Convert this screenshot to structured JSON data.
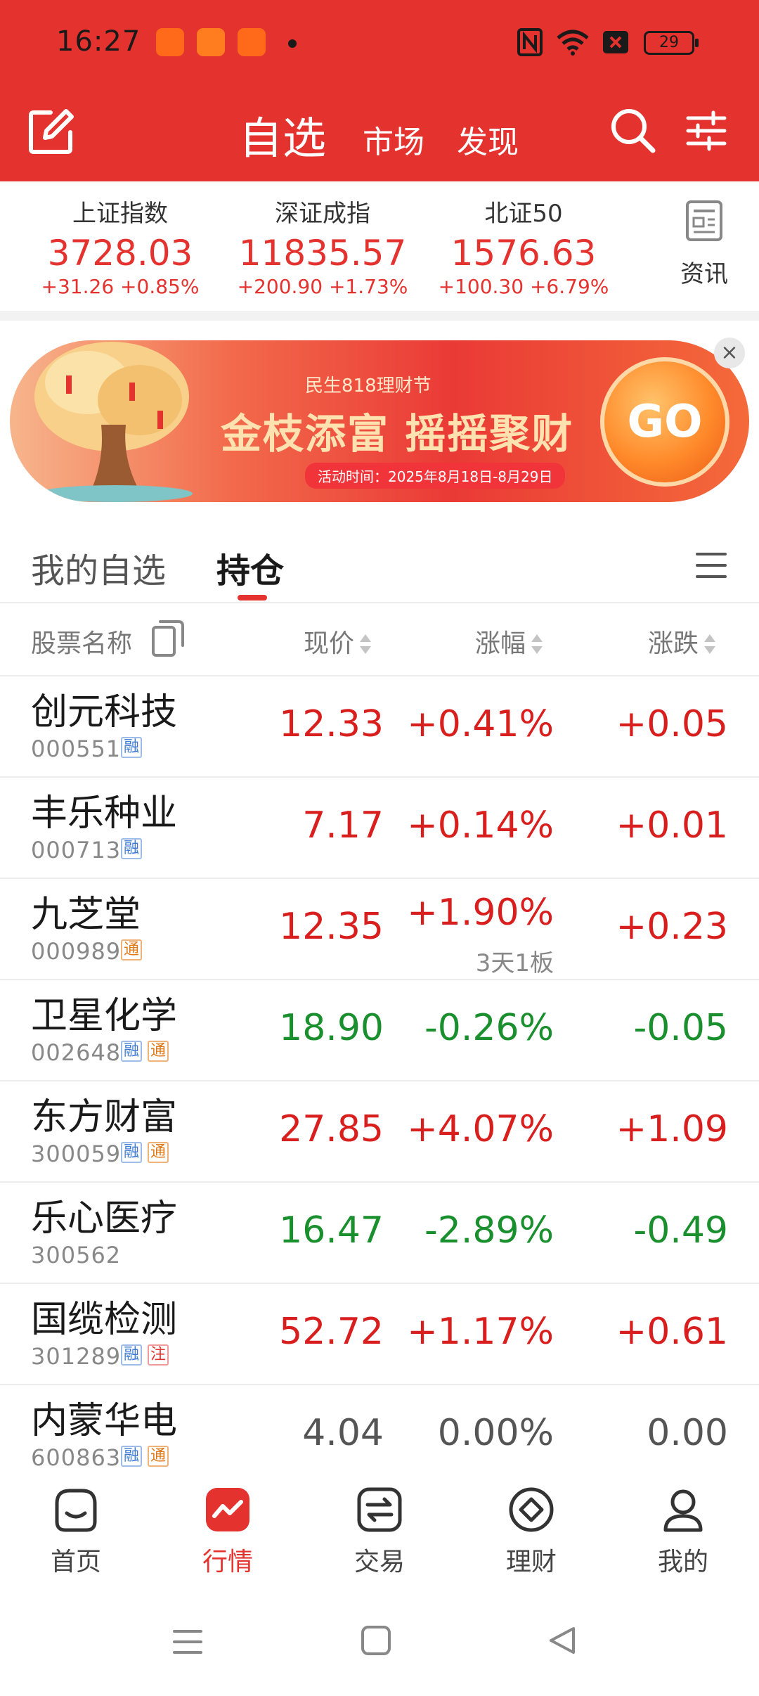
{
  "status_bar": {
    "time": "16:27",
    "battery": "29"
  },
  "nav": {
    "main_tab": "自选",
    "tabs": [
      "市场",
      "发现"
    ]
  },
  "indices": [
    {
      "name": "上证指数",
      "value": "3728.03",
      "change": "+31.26  +0.85%"
    },
    {
      "name": "深证成指",
      "value": "11835.57",
      "change": "+200.90  +1.73%"
    },
    {
      "name": "北证50",
      "value": "1576.63",
      "change": "+100.30  +6.79%"
    }
  ],
  "news": {
    "label": "资讯"
  },
  "banner": {
    "subtitle": "民生818理财节",
    "title": "金枝添富 摇摇聚财",
    "date": "活动时间：2025年8月18日-8月29日",
    "go": "GO"
  },
  "tabs": {
    "my_watchlist": "我的自选",
    "holdings": "持仓"
  },
  "table_header": {
    "name": "股票名称",
    "price": "现价",
    "pct": "涨幅",
    "change": "涨跌"
  },
  "stocks": [
    {
      "name": "创元科技",
      "code": "000551",
      "tags": [
        "融"
      ],
      "price": "12.33",
      "pct": "+0.41%",
      "change": "+0.05",
      "trend": "up"
    },
    {
      "name": "丰乐种业",
      "code": "000713",
      "tags": [
        "融"
      ],
      "price": "7.17",
      "pct": "+0.14%",
      "change": "+0.01",
      "trend": "up"
    },
    {
      "name": "九芝堂",
      "code": "000989",
      "tags": [
        "通"
      ],
      "price": "12.35",
      "pct": "+1.90%",
      "pct_note": "3天1板",
      "change": "+0.23",
      "trend": "up"
    },
    {
      "name": "卫星化学",
      "code": "002648",
      "tags": [
        "融",
        "通"
      ],
      "price": "18.90",
      "pct": "-0.26%",
      "change": "-0.05",
      "trend": "down"
    },
    {
      "name": "东方财富",
      "code": "300059",
      "tags": [
        "融",
        "通"
      ],
      "price": "27.85",
      "pct": "+4.07%",
      "change": "+1.09",
      "trend": "up"
    },
    {
      "name": "乐心医疗",
      "code": "300562",
      "tags": [],
      "price": "16.47",
      "pct": "-2.89%",
      "change": "-0.49",
      "trend": "down"
    },
    {
      "name": "国缆检测",
      "code": "301289",
      "tags": [
        "融",
        "注"
      ],
      "price": "52.72",
      "pct": "+1.17%",
      "change": "+0.61",
      "trend": "up"
    },
    {
      "name": "内蒙华电",
      "code": "600863",
      "tags": [
        "融",
        "通"
      ],
      "price": "4.04",
      "pct": "0.00%",
      "change": "0.00",
      "trend": "flat"
    }
  ],
  "bottom_nav": [
    {
      "label": "首页",
      "icon": "home-icon"
    },
    {
      "label": "行情",
      "icon": "market-icon",
      "active": true
    },
    {
      "label": "交易",
      "icon": "trade-icon"
    },
    {
      "label": "理财",
      "icon": "wealth-icon"
    },
    {
      "label": "我的",
      "icon": "profile-icon"
    }
  ],
  "colors": {
    "brand": "#e4322f",
    "up": "#d91e1e",
    "down": "#1a8f2e"
  }
}
